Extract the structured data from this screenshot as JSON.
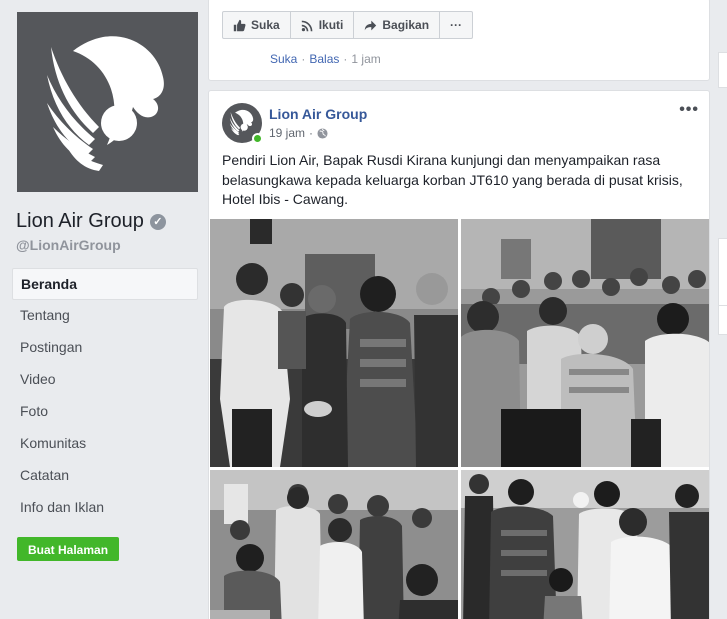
{
  "page": {
    "name": "Lion Air Group",
    "handle": "@LionAirGroup",
    "verified_icon": "check-icon"
  },
  "sidebar": {
    "items": [
      {
        "label": "Beranda",
        "active": true
      },
      {
        "label": "Tentang"
      },
      {
        "label": "Postingan"
      },
      {
        "label": "Video"
      },
      {
        "label": "Foto"
      },
      {
        "label": "Komunitas"
      },
      {
        "label": "Catatan"
      },
      {
        "label": "Info dan Iklan"
      }
    ],
    "create_button": "Buat Halaman"
  },
  "top_card": {
    "actions": [
      {
        "label": "Suka",
        "icon": "thumbs-up-icon"
      },
      {
        "label": "Ikuti",
        "icon": "rss-icon"
      },
      {
        "label": "Bagikan",
        "icon": "share-icon"
      },
      {
        "label": "···",
        "icon": "more-icon"
      }
    ],
    "comment_meta": {
      "like": "Suka",
      "reply": "Balas",
      "time": "1 jam"
    }
  },
  "post": {
    "author": "Lion Air Group",
    "time": "19 jam",
    "privacy_icon": "globe-icon",
    "menu": "•••",
    "text": "Pendiri Lion Air, Bapak Rusdi Kirana kunjungi dan menyampaikan rasa belasungkawa kepada keluarga korban JT610 yang berada di pusat krisis, Hotel Ibis - Cawang."
  },
  "colors": {
    "link": "#365899",
    "green": "#42b72a",
    "logo_bg": "#55575b"
  }
}
